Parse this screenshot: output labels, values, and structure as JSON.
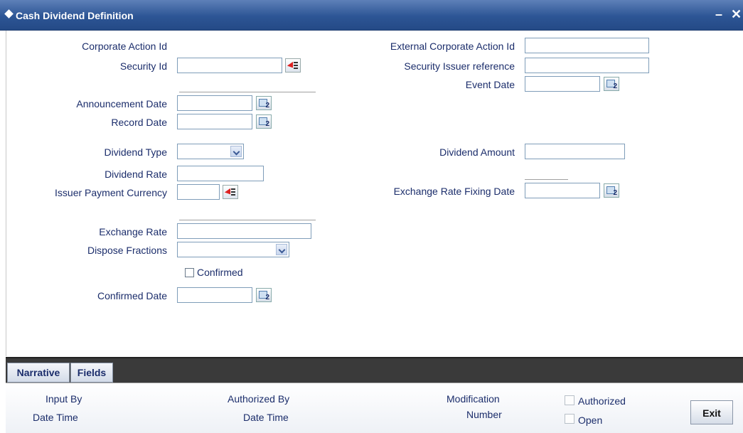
{
  "window": {
    "title": "Cash Dividend Definition",
    "minimize_label": "–",
    "close_label": "✕"
  },
  "form": {
    "corporate_action_id_label": "Corporate Action Id",
    "security_id_label": "Security Id",
    "announcement_date_label": "Announcement Date",
    "record_date_label": "Record Date",
    "dividend_type_label": "Dividend Type",
    "dividend_rate_label": "Dividend Rate",
    "issuer_payment_currency_label": "Issuer Payment Currency",
    "exchange_rate_label": "Exchange Rate",
    "dispose_fractions_label": "Dispose Fractions",
    "confirmed_label": "Confirmed",
    "confirmed_date_label": "Confirmed Date",
    "external_corporate_action_id_label": "External Corporate Action Id",
    "security_issuer_reference_label": "Security Issuer reference",
    "event_date_label": "Event Date",
    "dividend_amount_label": "Dividend Amount",
    "exchange_rate_fixing_date_label": "Exchange Rate Fixing Date",
    "calendar_icon_text": "2"
  },
  "tabs": [
    {
      "label": "Narrative"
    },
    {
      "label": "Fields"
    }
  ],
  "footer": {
    "input_by_label": "Input By",
    "date_time_label_1": "Date Time",
    "authorized_by_label": "Authorized By",
    "date_time_label_2": "Date Time",
    "modification_label": "Modification",
    "number_label": "Number",
    "authorized_label": "Authorized",
    "open_label": "Open",
    "exit_label": "Exit"
  },
  "colors": {
    "title_bar": "#2d5595",
    "label_text": "#1b2d6b",
    "tab_bar": "#3a3a3a"
  }
}
